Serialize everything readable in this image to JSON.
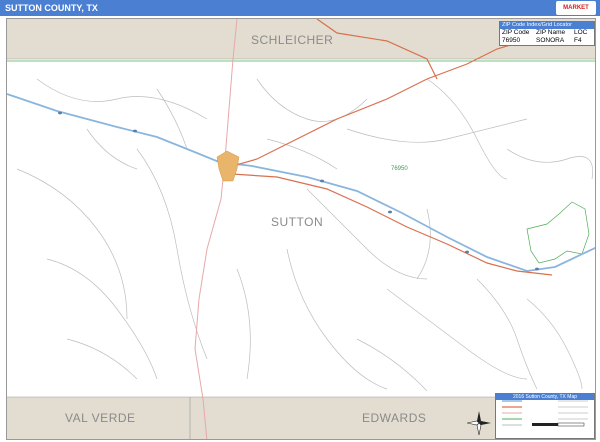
{
  "header": {
    "title": "SUTTON COUNTY, TX",
    "logo_text": "Market Maps"
  },
  "map": {
    "counties": {
      "north": "SCHLEICHER",
      "center": "SUTTON",
      "southwest": "VAL VERDE",
      "southeast": "EDWARDS"
    },
    "zip_label": "76950",
    "colors": {
      "neighbor_fill": "#e2ddd0",
      "interstate": "#8ab6de",
      "highway": "#d9704f",
      "minor_road": "#e8a8a8",
      "local_road": "#bdbdbd",
      "zip_boundary": "#4caf50",
      "title_bar": "#4b7fd1"
    }
  },
  "locator": {
    "heading": "ZIP Code Index/Grid Locator",
    "columns": [
      "ZIP Code",
      "ZIP Name",
      "LOC"
    ],
    "rows": [
      [
        "76950",
        "SONORA",
        "F4"
      ]
    ]
  },
  "legend": {
    "heading": "2016 Sutton County, TX Map"
  }
}
